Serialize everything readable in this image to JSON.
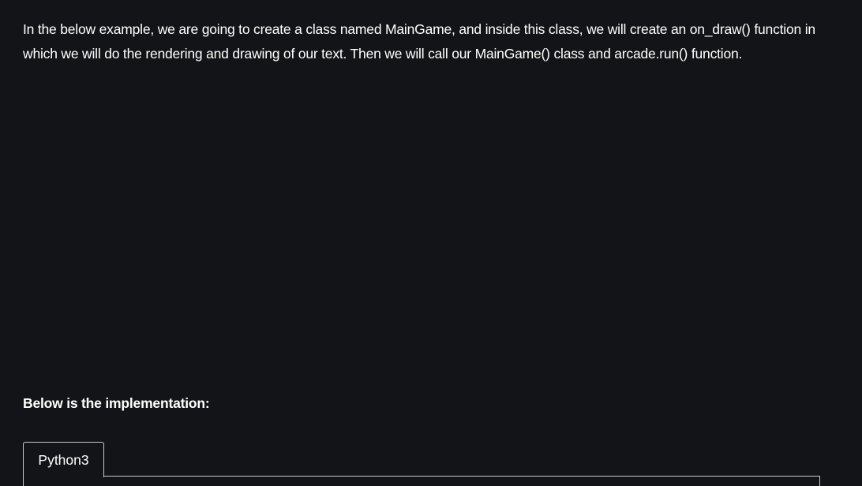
{
  "article": {
    "intro_text": "In the below example, we are going to create a class named MainGame, and inside this class, we will create an on_draw() function in which we will do the rendering and drawing of our text. Then we will call our MainGame() class and arcade.run() function.",
    "implementation_heading": "Below is the implementation:"
  },
  "code_block": {
    "tabs": [
      {
        "label": "Python3",
        "active": true
      }
    ]
  },
  "colors": {
    "background": "#131417",
    "text": "#ffffff",
    "border": "#c9c9c9"
  }
}
